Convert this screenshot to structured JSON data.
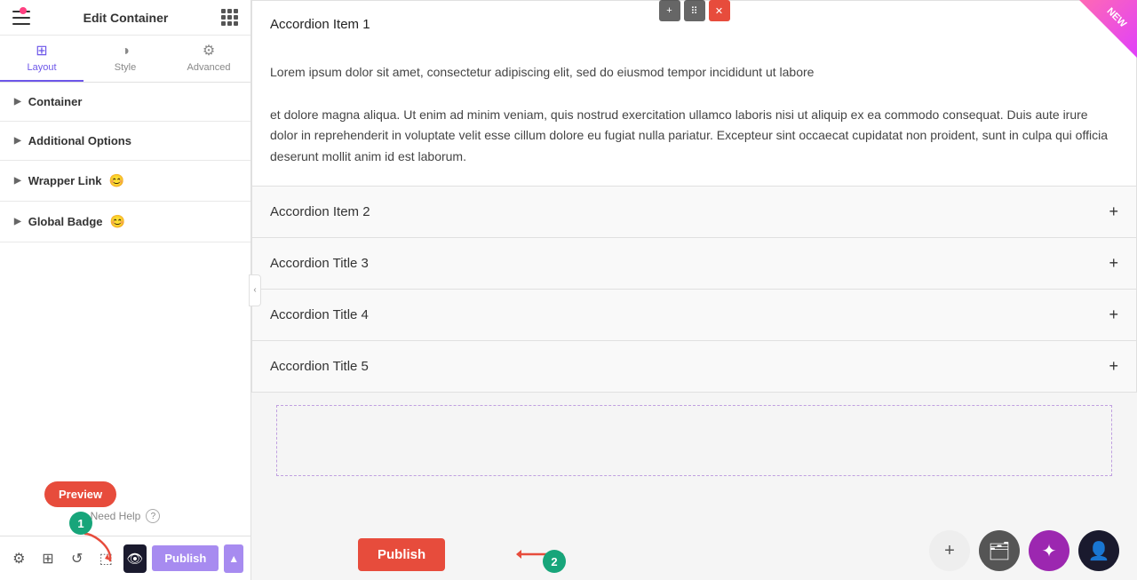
{
  "panel": {
    "title": "Edit Container",
    "tabs": [
      {
        "id": "layout",
        "label": "Layout",
        "icon": "⊞",
        "active": true
      },
      {
        "id": "style",
        "label": "Style",
        "icon": "◑",
        "active": false
      },
      {
        "id": "advanced",
        "label": "Advanced",
        "icon": "⚙",
        "active": false
      }
    ],
    "sections": [
      {
        "id": "container",
        "label": "Container",
        "icon": null
      },
      {
        "id": "additional-options",
        "label": "Additional Options",
        "icon": null
      },
      {
        "id": "wrapper-link",
        "label": "Wrapper Link",
        "icon": "😊"
      },
      {
        "id": "global-badge",
        "label": "Global Badge",
        "icon": "😊"
      }
    ],
    "need_help": "Need Help",
    "bottom_bar": {
      "publish_label": "Publish",
      "chevron": "▲",
      "preview_label": "Preview"
    }
  },
  "accordion": {
    "title": "Accordion Item 1",
    "new_badge": "NEW",
    "body_text_1": "Lorem ipsum dolor sit amet, consectetur adipiscing elit, sed do eiusmod tempor incididunt ut labore",
    "body_text_2": "et dolore magna aliqua. Ut enim ad minim veniam, quis nostrud exercitation ullamco laboris nisi ut aliquip ex ea commodo consequat. Duis aute irure dolor in reprehenderit in voluptate velit esse cillum dolore eu fugiat nulla pariatur. Excepteur sint occaecat cupidatat non proident, sunt in culpa qui officia deserunt mollit anim id est laborum.",
    "items": [
      {
        "title": "Accordion Item 2",
        "open": false
      },
      {
        "title": "Accordion Title 3",
        "open": false
      },
      {
        "title": "Accordion Title 4",
        "open": false
      },
      {
        "title": "Accordion Title 5",
        "open": false
      }
    ]
  },
  "toolbar": {
    "plus": "+",
    "move": "⠿",
    "close": "✕"
  },
  "floating": {
    "publish_label": "Publish",
    "step1": "1",
    "step2": "2"
  }
}
